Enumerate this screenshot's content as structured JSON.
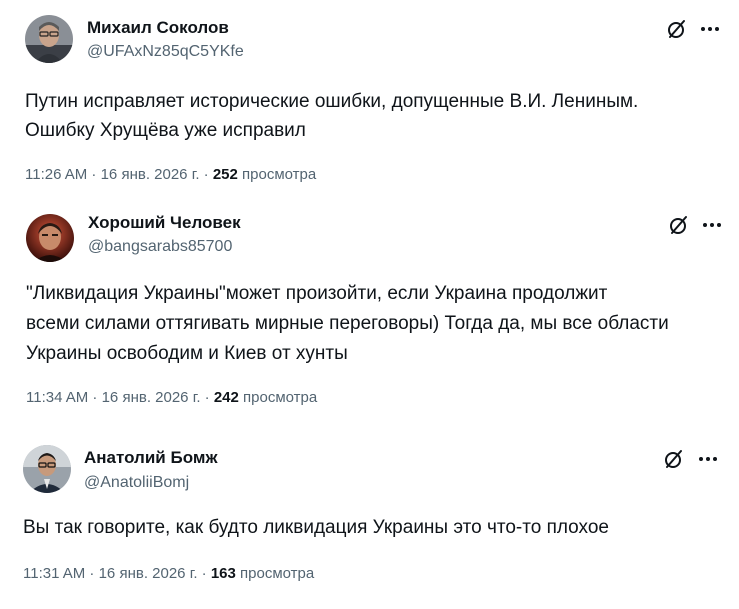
{
  "tweets": [
    {
      "author_name": "Михаил Соколов",
      "handle": "@UFAxNz85qC5YKfe",
      "lines": [
        "Путин исправляет исторические ошибки, допущенные В.И. Лениным.",
        "Ошибку Хрущёва уже исправил"
      ],
      "time": "11:26 AM · 16 янв. 2026 г. · ",
      "views_count": "252",
      "views_label": " просмотра"
    },
    {
      "author_name": "Хороший Человек",
      "handle": "@bangsarabs85700",
      "lines": [
        "\"Ликвидация Украины\"может произойти, если Украина продолжит",
        "всеми силами оттягивать мирные переговоры) Тогда да, мы все области",
        "Украины освободим и Киев от хунты"
      ],
      "time": "11:34 AM · 16 янв. 2026 г. · ",
      "views_count": "242",
      "views_label": " просмотра"
    },
    {
      "author_name": "Анатолий Бомж",
      "handle": "@AnatoliiBomj",
      "lines": [
        "Вы так говорите, как будто ликвидация Украины это что-то плохое"
      ],
      "time": "11:31 AM · 16 янв. 2026 г. · ",
      "views_count": "163",
      "views_label": " просмотра"
    }
  ],
  "icons": {
    "grok": "grok-icon",
    "more": "more-icon"
  },
  "colors": {
    "text": "#0f1419",
    "secondary": "#536471"
  }
}
